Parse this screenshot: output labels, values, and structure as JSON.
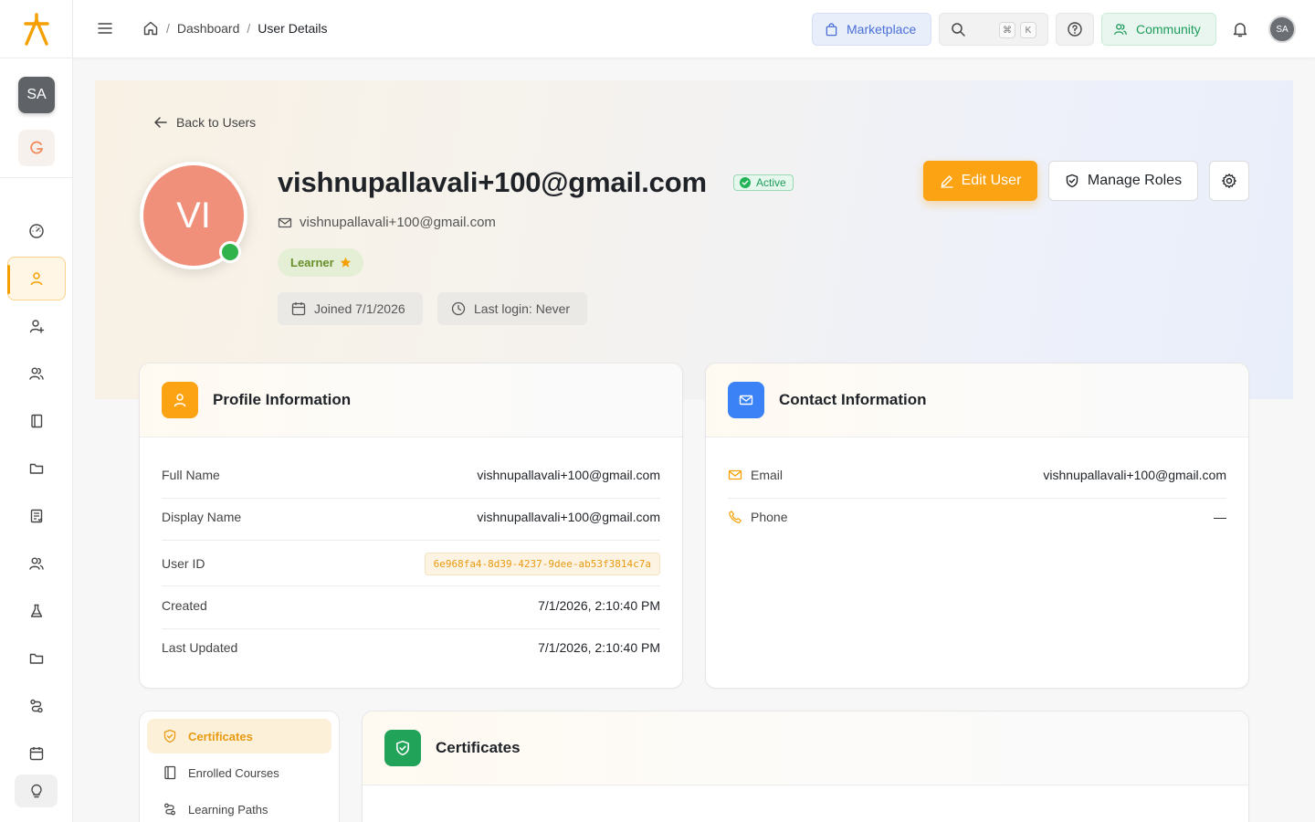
{
  "colors": {
    "accent": "#fba313",
    "success": "#2fb34a",
    "info": "#3b82f6"
  },
  "sidebar": {
    "avatar_initials": "SA",
    "nav_icons": [
      "gauge-icon",
      "user-icon",
      "user-plus-icon",
      "users-icon",
      "book-icon",
      "folder-icon",
      "clipboard-icon",
      "group-icon",
      "flask-icon",
      "folder-icon",
      "route-icon",
      "calendar-icon"
    ],
    "active_index": 1
  },
  "header": {
    "breadcrumb": {
      "home": "home-icon",
      "dashboard": "Dashboard",
      "current": "User Details"
    },
    "marketplace_label": "Marketplace",
    "search_key_cmd": "⌘",
    "search_key_k": "K",
    "community_label": "Community",
    "avatar_initials": "SA"
  },
  "hero": {
    "back_label": "Back to Users",
    "avatar_initials": "VI",
    "title": "vishnupallavali+100@gmail.com",
    "status": "Active",
    "email": "vishnupallavali+100@gmail.com",
    "role": "Learner",
    "joined": "Joined 7/1/2026",
    "last_login": "Last login: Never",
    "edit_label": "Edit User",
    "roles_label": "Manage Roles"
  },
  "profile": {
    "title": "Profile Information",
    "rows": [
      {
        "label": "Full Name",
        "value": "vishnupallavali+100@gmail.com"
      },
      {
        "label": "Display Name",
        "value": "vishnupallavali+100@gmail.com"
      },
      {
        "label": "User ID",
        "value": "6e968fa4-8d39-4237-9dee-ab53f3814c7a"
      },
      {
        "label": "Created",
        "value": "7/1/2026, 2:10:40 PM"
      },
      {
        "label": "Last Updated",
        "value": "7/1/2026, 2:10:40 PM"
      }
    ]
  },
  "contact": {
    "title": "Contact Information",
    "rows": [
      {
        "label": "Email",
        "value": "vishnupallavali+100@gmail.com"
      },
      {
        "label": "Phone",
        "value": "—"
      }
    ]
  },
  "tabs": [
    "Certificates",
    "Enrolled Courses",
    "Learning Paths"
  ],
  "certificates": {
    "title": "Certificates"
  }
}
